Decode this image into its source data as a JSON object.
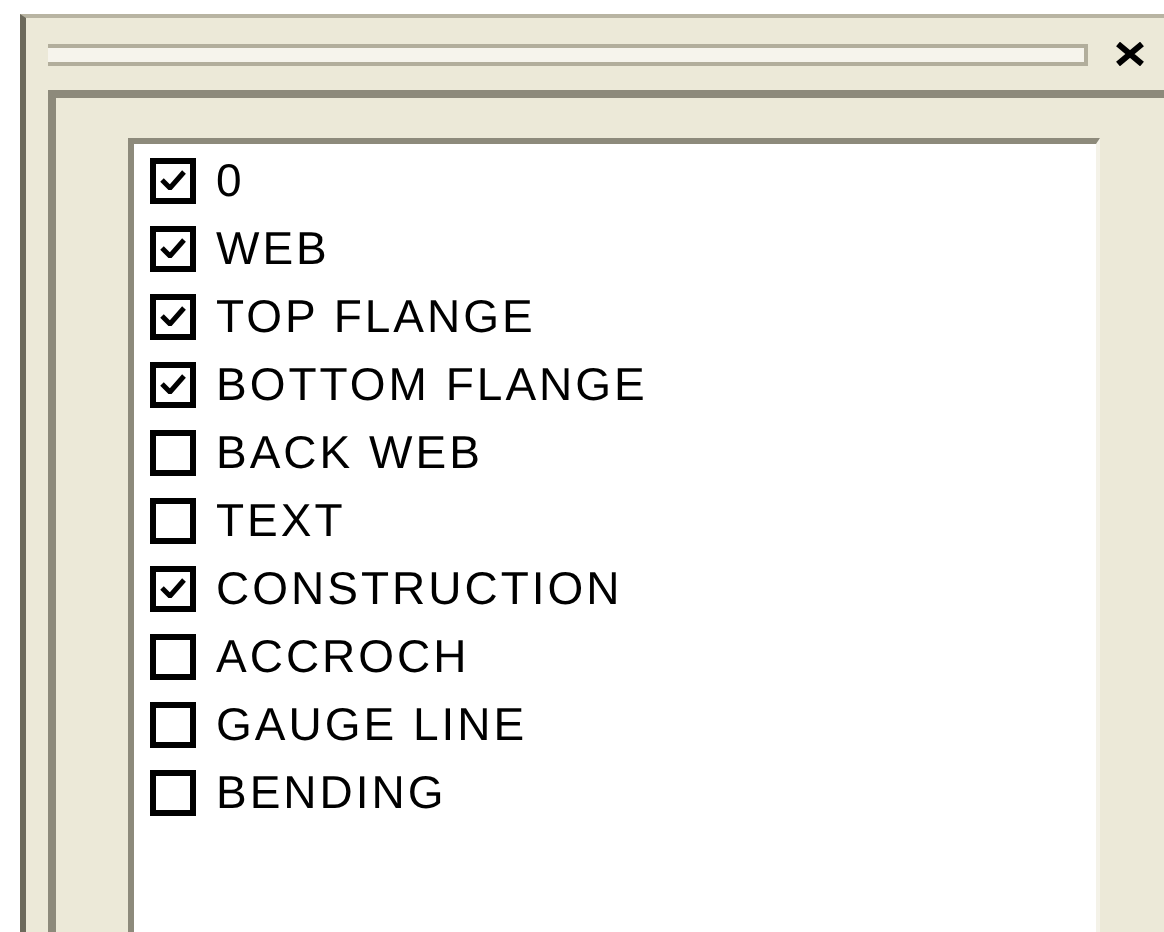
{
  "layers": [
    {
      "label": "0",
      "checked": true
    },
    {
      "label": "WEB",
      "checked": true
    },
    {
      "label": "TOP FLANGE",
      "checked": true
    },
    {
      "label": "BOTTOM FLANGE",
      "checked": true
    },
    {
      "label": "BACK WEB",
      "checked": false
    },
    {
      "label": "TEXT",
      "checked": false
    },
    {
      "label": "CONSTRUCTION",
      "checked": true
    },
    {
      "label": "ACCROCH",
      "checked": false
    },
    {
      "label": "GAUGE LINE",
      "checked": false
    },
    {
      "label": "BENDING",
      "checked": false
    }
  ]
}
